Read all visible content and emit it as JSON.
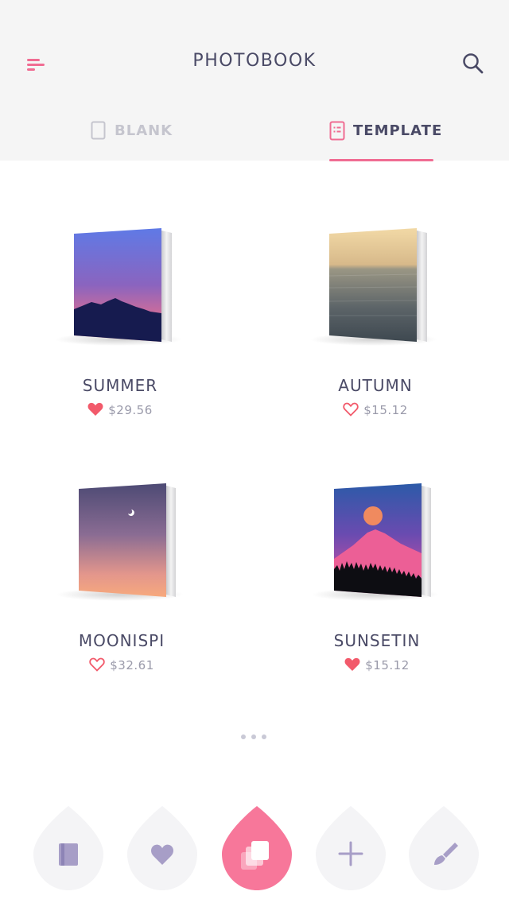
{
  "header": {
    "title": "PHOTOBOOK",
    "menu_icon": "menu-icon",
    "search_icon": "search-icon"
  },
  "tabs": [
    {
      "label": "BLANK",
      "icon": "blank-page-icon",
      "active": false
    },
    {
      "label": "TEMPLATE",
      "icon": "template-page-icon",
      "active": true
    }
  ],
  "templates": [
    {
      "name": "SUMMER",
      "price": "$29.56",
      "favorited": true
    },
    {
      "name": "AUTUMN",
      "price": "$15.12",
      "favorited": false
    },
    {
      "name": "MOONISPI",
      "price": "$32.61",
      "favorited": false
    },
    {
      "name": "SUNSETIN",
      "price": "$15.12",
      "favorited": true
    }
  ],
  "pager": {
    "pages": 3
  },
  "bottom_nav": [
    {
      "icon": "book-icon",
      "active": false
    },
    {
      "icon": "heart-icon",
      "active": false
    },
    {
      "icon": "layers-icon",
      "active": true
    },
    {
      "icon": "plus-icon",
      "active": false
    },
    {
      "icon": "brush-icon",
      "active": false
    }
  ],
  "colors": {
    "accent": "#f06c92",
    "heart": "#f25a6b",
    "text": "#4a4a66",
    "muted": "#9a9aaa",
    "nav_bg": "#f4f4f6",
    "nav_icon": "#a79ec7"
  }
}
